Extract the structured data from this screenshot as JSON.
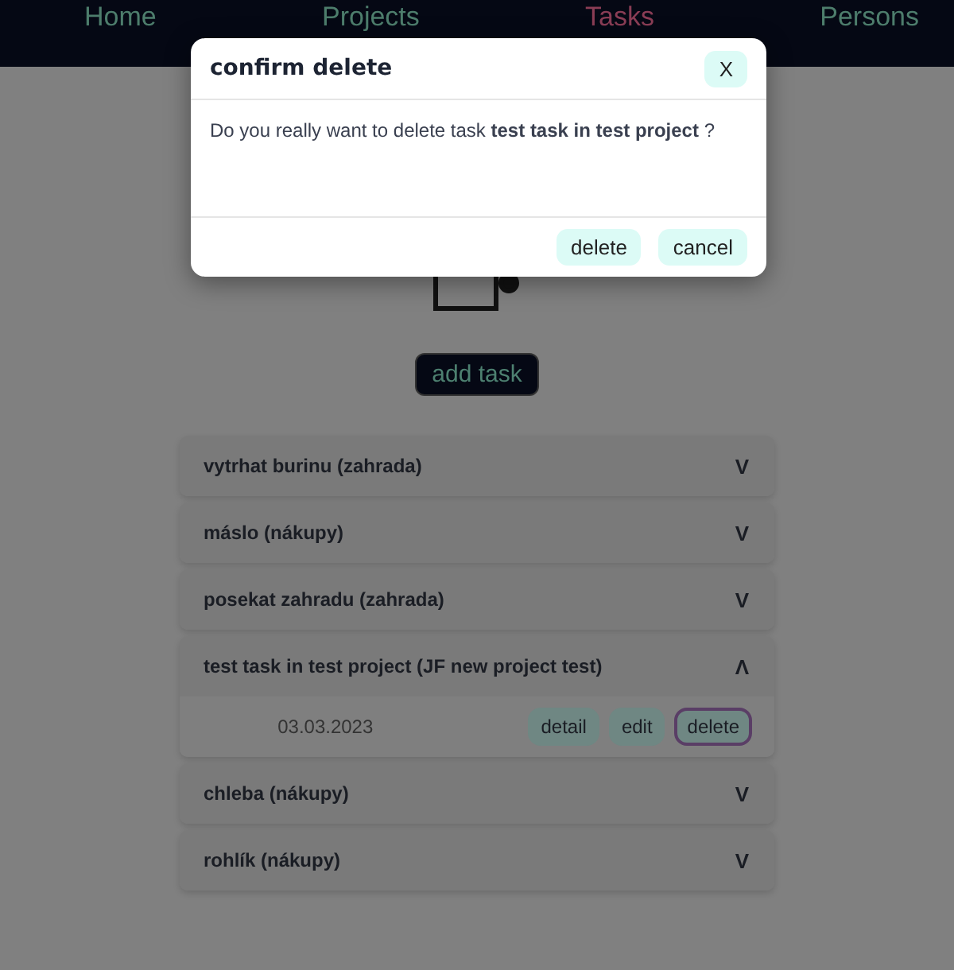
{
  "nav": [
    {
      "label": "Home",
      "selected": false
    },
    {
      "label": "Projects",
      "selected": false
    },
    {
      "label": "Tasks",
      "selected": true
    },
    {
      "label": "Persons",
      "selected": false
    }
  ],
  "add_button": "add task",
  "tasks": [
    {
      "title": "vytrhat burinu (zahrada)",
      "toggle": "V",
      "expanded": false
    },
    {
      "title": "máslo (nákupy)",
      "toggle": "V",
      "expanded": false
    },
    {
      "title": "posekat zahradu (zahrada)",
      "toggle": "V",
      "expanded": false
    },
    {
      "title": "test task in test project (JF new project test)",
      "toggle": "Λ",
      "expanded": true,
      "date": "03.03.2023",
      "actions": [
        {
          "label": "detail",
          "selected": false
        },
        {
          "label": "edit",
          "selected": false
        },
        {
          "label": "delete",
          "selected": true
        }
      ]
    },
    {
      "title": "chleba (nákupy)",
      "toggle": "V",
      "expanded": false
    },
    {
      "title": "rohlík (nákupy)",
      "toggle": "V",
      "expanded": false
    }
  ],
  "dialog": {
    "title": "confirm delete",
    "close": "X",
    "message": "Do you really want to delete task **test task in test project** ?",
    "buttons": [
      "delete",
      "cancel"
    ]
  }
}
